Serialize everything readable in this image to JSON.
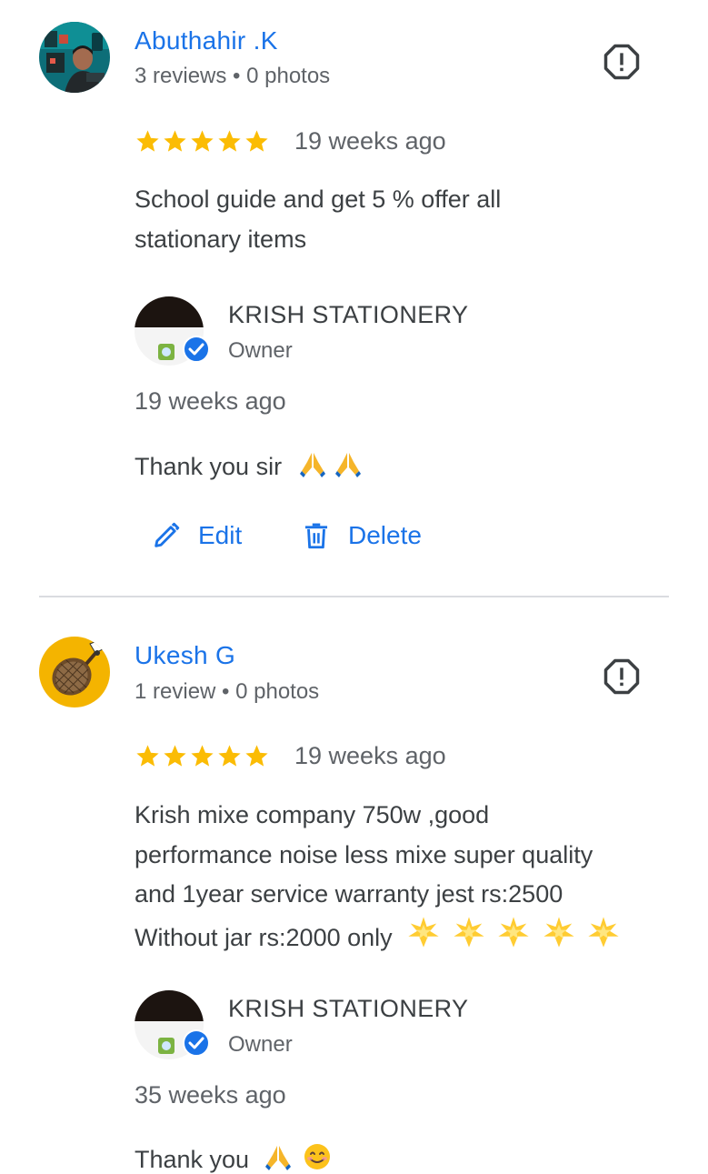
{
  "reviews": [
    {
      "name": "Abuthahir .K",
      "meta": "3 reviews • 0 photos",
      "rating": 5,
      "time": "19 weeks ago",
      "text_lines": [
        "School guide and get 5 % offer all",
        "stationary items"
      ],
      "owner": {
        "name": "KRISH STATIONERY",
        "role": "Owner",
        "time": "19 weeks ago",
        "reply": "Thank you sir",
        "reply_emoji": [
          "folded-hands",
          "folded-hands"
        ]
      },
      "actions": {
        "edit_label": "Edit",
        "delete_label": "Delete"
      }
    },
    {
      "name": "Ukesh G",
      "meta": "1 review • 0 photos",
      "rating": 5,
      "time": "19 weeks ago",
      "text_lines": [
        "Krish mixe company 750w ,good",
        "performance noise less mixe super quality",
        "and 1year service warranty jest rs:2500",
        "Without jar rs:2000 only"
      ],
      "text_emoji": [
        "glowing-star",
        "glowing-star",
        "glowing-star",
        "glowing-star",
        "glowing-star"
      ],
      "owner": {
        "name": "KRISH STATIONERY",
        "role": "Owner",
        "time": "35 weeks ago",
        "reply": "Thank you",
        "reply_emoji": [
          "folded-hands",
          "smiling-face"
        ]
      }
    }
  ],
  "colors": {
    "link_blue": "#1a73e8",
    "star_yellow": "#fbbc04",
    "text": "#3c4043",
    "secondary_text": "#5f6368",
    "divider": "#dadce0",
    "verified_blue": "#1a73e8"
  }
}
